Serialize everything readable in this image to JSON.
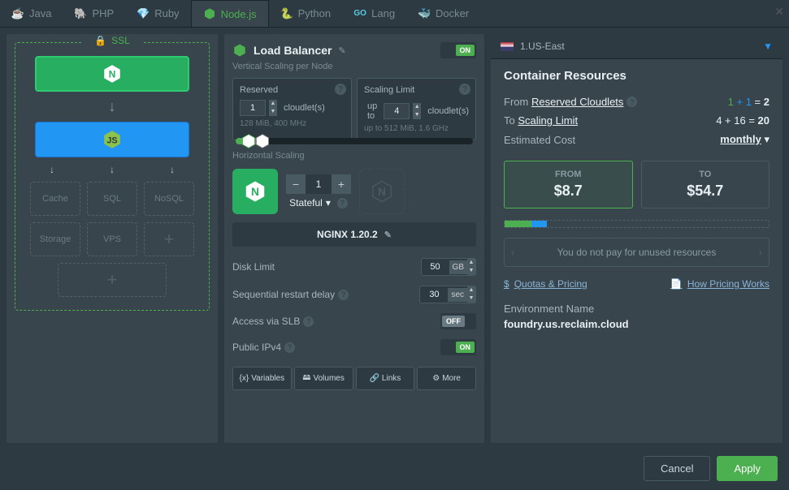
{
  "tabs": [
    "Java",
    "PHP",
    "Ruby",
    "Node.js",
    "Python",
    "Lang",
    "Docker"
  ],
  "activeTab": "Node.js",
  "region": "1.US-East",
  "ssl": {
    "label": "SSL"
  },
  "topology": {
    "ghost1": [
      "Cache",
      "SQL",
      "NoSQL"
    ],
    "ghost2": [
      "Storage",
      "VPS"
    ]
  },
  "balancer": {
    "title": "Load Balancer",
    "toggle": "ON",
    "subtitle": "Vertical Scaling per Node",
    "reserved": {
      "label": "Reserved",
      "value": "1",
      "unit": "cloudlet(s)",
      "info": "128 MiB, 400 MHz"
    },
    "limit": {
      "label": "Scaling Limit",
      "prefix": "up to",
      "value": "4",
      "unit": "cloudlet(s)",
      "info": "up to 512 MiB, 1.6 GHz"
    },
    "sliderMin": "0",
    "sliderMax": "64",
    "hscale": {
      "label": "Horizontal Scaling",
      "count": "1",
      "mode": "Stateful"
    },
    "version": "NGINX 1.20.2",
    "disk": {
      "label": "Disk Limit",
      "value": "50",
      "unit": "GB"
    },
    "restart": {
      "label": "Sequential restart delay",
      "value": "30",
      "unit": "sec"
    },
    "slb": {
      "label": "Access via SLB",
      "value": "OFF"
    },
    "ipv4": {
      "label": "Public IPv4",
      "value": "ON"
    },
    "buttons": [
      "Variables",
      "Volumes",
      "Links",
      "More"
    ]
  },
  "resources": {
    "title": "Container Resources",
    "from": {
      "label": "From",
      "link": "Reserved Cloudlets",
      "expr1": "1",
      "plus": "+",
      "expr2": "1",
      "eq": "=",
      "total": "2"
    },
    "to": {
      "label": "To",
      "link": "Scaling Limit",
      "expr": "4 + 16 = ",
      "total": "20"
    },
    "est": {
      "label": "Estimated Cost",
      "period": "monthly"
    },
    "costFrom": {
      "label": "FROM",
      "value": "$8.7"
    },
    "costTo": {
      "label": "TO",
      "value": "$54.7"
    },
    "info": "You do not pay for unused resources",
    "quotas": "Quotas & Pricing",
    "howPricing": "How Pricing Works",
    "envLabel": "Environment Name",
    "envValue": "foundry.us.reclaim.cloud"
  },
  "footer": {
    "cancel": "Cancel",
    "apply": "Apply"
  }
}
